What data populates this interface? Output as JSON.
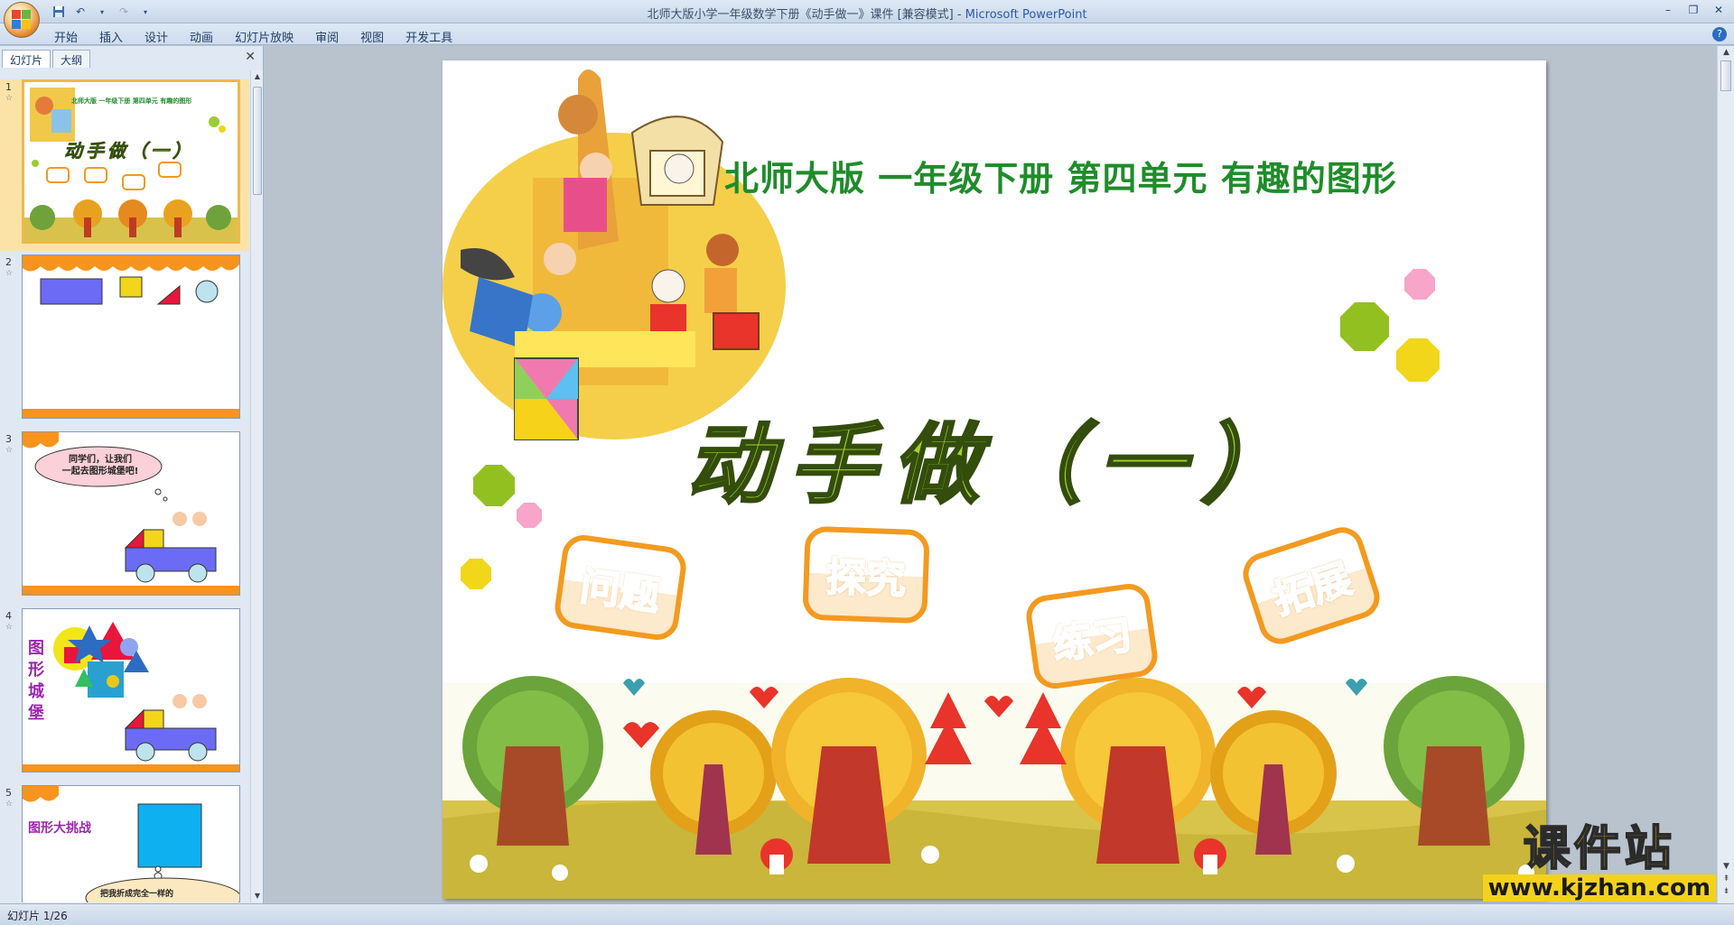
{
  "window": {
    "title": "北师大版小学一年级数学下册《动手做一》课件 [兼容模式] - ",
    "app_name": "Microsoft PowerPoint"
  },
  "ribbon": {
    "tabs": [
      "开始",
      "插入",
      "设计",
      "动画",
      "幻灯片放映",
      "审阅",
      "视图",
      "开发工具"
    ]
  },
  "panel": {
    "tabs": [
      "幻灯片",
      "大纲"
    ],
    "slides": [
      {
        "number": "1",
        "title": "北师大版  一年级下册  第四单元  有趣的图形",
        "main": "动手做（一）"
      },
      {
        "number": "2"
      },
      {
        "number": "3",
        "bubble_line1": "同学们，让我们",
        "bubble_line2": "一起去图形城堡吧!"
      },
      {
        "number": "4",
        "side_text": "图形城堡"
      },
      {
        "number": "5",
        "label": "图形大挑战",
        "bubble_line1": "把我折成完全一样的"
      }
    ]
  },
  "slide": {
    "subtitle": "北师大版  一年级下册  第四单元  有趣的图形",
    "title": "动手做（一）",
    "buttons": [
      "问题",
      "探究",
      "练习",
      "拓展"
    ]
  },
  "watermark": {
    "brand": "课件站",
    "url": "www.kjzhan.com"
  },
  "status": {
    "slide_counter": "幻灯片 1/26"
  },
  "colors": {
    "title_green": "#1f8c2a",
    "main_title_lime": "#a8cf2e",
    "badge_orange": "#f39a1f",
    "thumb_orange": "#f7941d",
    "watermark_yellow": "#f4d21a"
  }
}
